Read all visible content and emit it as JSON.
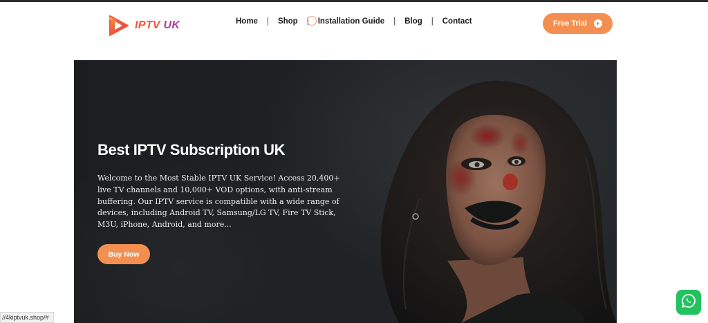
{
  "brand": {
    "part1": "IPTV",
    "part2": "UK",
    "icon": "play-logo-icon"
  },
  "nav": {
    "items": [
      {
        "label": "Home"
      },
      {
        "label": "Shop"
      },
      {
        "label": "Installation Guide"
      },
      {
        "label": "Blog"
      },
      {
        "label": "Contact"
      }
    ],
    "separator": "|"
  },
  "header": {
    "trial_label": "Free Trial",
    "trial_icon": "play-circle-icon"
  },
  "hero": {
    "title": "Best IPTV Subscription UK",
    "text": "Welcome to the Most Stable IPTV UK Service! Access 20,400+ live TV channels and 10,000+ VOD options, with anti-stream buffering. Our IPTV service is compatible with a wide range of devices, including Android TV, Samsung/LG TV, Fire TV Stick, M3U, iPhone, Android, and more...",
    "button_label": "Buy Now"
  },
  "status_bar": {
    "url": "//4kiptvuk.shop/#"
  },
  "floating": {
    "icon": "whatsapp-icon"
  },
  "colors": {
    "accent": "#f48f52",
    "logo_orange": "#f0573b",
    "logo_purple": "#b8389f",
    "whatsapp": "#22c25e",
    "hero_bg": "#232529"
  }
}
